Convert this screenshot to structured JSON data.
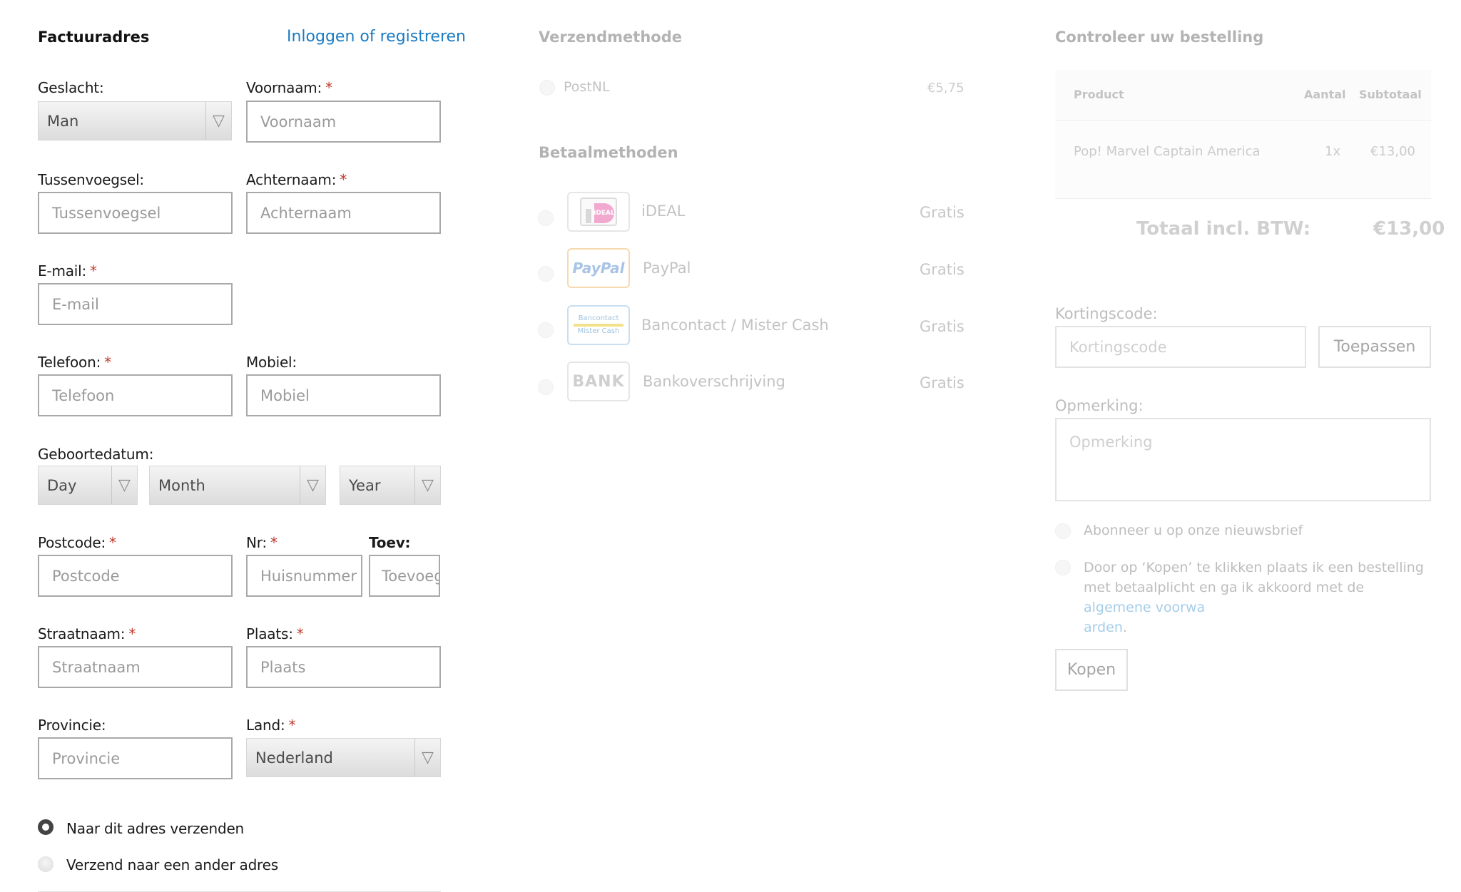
{
  "billing": {
    "title": "Factuuradres",
    "login_link": "Inloggen of registreren",
    "gender": {
      "label": "Geslacht:",
      "value": "Man"
    },
    "firstname": {
      "label": "Voornaam:",
      "placeholder": "Voornaam"
    },
    "infix": {
      "label": "Tussenvoegsel:",
      "placeholder": "Tussenvoegsel"
    },
    "lastname": {
      "label": "Achternaam:",
      "placeholder": "Achternaam"
    },
    "email": {
      "label": "E-mail:",
      "placeholder": "E-mail"
    },
    "phone": {
      "label": "Telefoon:",
      "placeholder": "Telefoon"
    },
    "mobile": {
      "label": "Mobiel:",
      "placeholder": "Mobiel"
    },
    "birthdate": {
      "label": "Geboortedatum:",
      "day": "Day",
      "month": "Month",
      "year": "Year"
    },
    "postcode": {
      "label": "Postcode:",
      "placeholder": "Postcode"
    },
    "number": {
      "label": "Nr:",
      "placeholder": "Huisnummer"
    },
    "addition": {
      "label": "Toev:",
      "placeholder": "Toevoeging"
    },
    "street": {
      "label": "Straatnaam:",
      "placeholder": "Straatnaam"
    },
    "city": {
      "label": "Plaats:",
      "placeholder": "Plaats"
    },
    "province": {
      "label": "Provincie:",
      "placeholder": "Provincie"
    },
    "country": {
      "label": "Land:",
      "value": "Nederland"
    },
    "ship_same": "Naar dit adres verzenden",
    "ship_other": "Verzend naar een ander adres",
    "required_mark": "*"
  },
  "shipping": {
    "title": "Verzendmethode",
    "method": {
      "name": "PostNL",
      "price": "€5,75"
    }
  },
  "payment": {
    "title": "Betaalmethoden",
    "methods": [
      {
        "name": "iDEAL",
        "price": "Gratis",
        "logo": "iDEAL"
      },
      {
        "name": "PayPal",
        "price": "Gratis",
        "logo": "PayPal"
      },
      {
        "name": "Bancontact / Mister Cash",
        "price": "Gratis",
        "logo_top": "Bancontact",
        "logo_bottom": "Mister Cash"
      },
      {
        "name": "Bankoverschrijving",
        "price": "Gratis",
        "logo": "BANK"
      }
    ]
  },
  "review": {
    "title": "Controleer uw bestelling",
    "columns": {
      "product": "Product",
      "qty": "Aantal",
      "subtotal": "Subtotaal"
    },
    "items": [
      {
        "product": "Pop! Marvel Captain America",
        "qty": "1x",
        "subtotal": "€13,00"
      }
    ],
    "total_label": "Totaal incl. BTW:",
    "total_value": "€13,00",
    "coupon": {
      "label": "Kortingscode:",
      "placeholder": "Kortingscode",
      "button": "Toepassen"
    },
    "remark": {
      "label": "Opmerking:",
      "placeholder": "Opmerking"
    },
    "newsletter": "Abonneer u op onze nieuwsbrief",
    "terms_text": "Door op ‘Kopen’ te klikken plaats ik een bestelling met betaalplicht en ga ik akkoord met de",
    "terms_link_1": "algemene voorwa",
    "terms_link_2": "arden",
    "terms_end": ".",
    "buy_button": "Kopen"
  },
  "colors": {
    "link": "#1a7bc4",
    "required": "#c0392b"
  }
}
